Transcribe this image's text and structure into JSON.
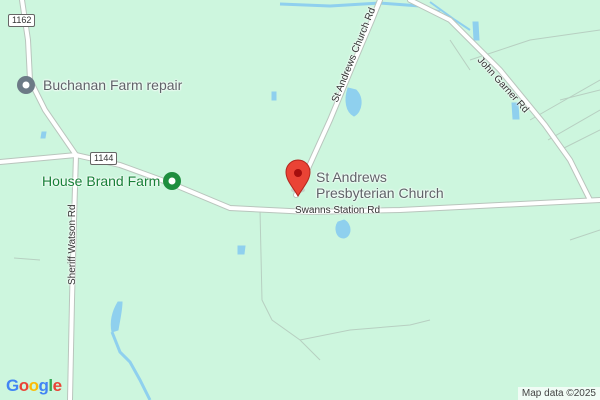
{
  "map": {
    "colors": {
      "background": "#cdf6de",
      "road": "#ffffff",
      "road_outline": "#b9c5bd",
      "water": "#8fd0ee",
      "pin_red": "#ea4335",
      "poi_gray": "#6c7a86",
      "poi_green": "#1e8e3e"
    },
    "pois": {
      "buchanan": "Buchanan Farm repair",
      "house_brand": "House Brand Farm",
      "church_line1": "St Andrews",
      "church_line2": "Presbyterian Church"
    },
    "roads": {
      "route_1162": "1162",
      "route_1144": "1144",
      "sheriff_watson": "Sheriff Watson Rd",
      "st_andrews_church": "St Andrews Church Rd",
      "john_garner": "John Garner Rd",
      "swanns_station": "Swanns Station Rd"
    },
    "icons": {
      "buchanan": "place-pin-icon",
      "house_brand": "farm-pin-icon",
      "church": "red-marker-icon"
    },
    "logo": {
      "g": "G",
      "o1": "o",
      "o2": "o",
      "g2": "g",
      "l": "l",
      "e": "e"
    },
    "attribution": "Map data ©2025"
  }
}
